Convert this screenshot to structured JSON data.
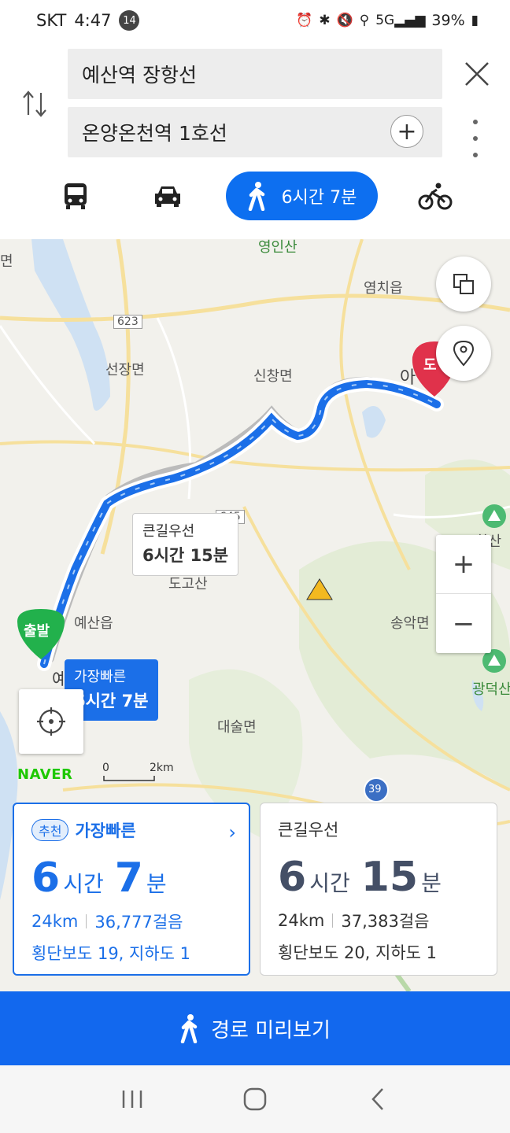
{
  "status": {
    "carrier": "SKT",
    "time": "4:47",
    "notif_count": "14",
    "battery": "39%"
  },
  "search": {
    "origin": "예산역 장항선",
    "destination": "온양온천역 1호선"
  },
  "tabs": {
    "walk_label": "6시간 7분"
  },
  "map": {
    "labels": [
      "영인산",
      "염치읍",
      "623",
      "선장면",
      "신창면",
      "큰길우선",
      "645",
      "도고산",
      "예산읍",
      "송악면",
      "대술면",
      "39",
      "광덕산",
      "면",
      "화산",
      "예산",
      "아",
      "도"
    ],
    "tip_alt": {
      "title": "큰길우선",
      "time": "6시간 15분"
    },
    "tip_fast": {
      "title": "가장빠른",
      "time": "6시간 7분"
    },
    "start_marker": "출발",
    "end_marker": "도",
    "scale_0": "0",
    "scale_2": "2km",
    "logo": "NAVER"
  },
  "routes": [
    {
      "badge": "추천",
      "title": "가장빠른",
      "hours": "6",
      "hours_unit": "시간",
      "minutes": "7",
      "minutes_unit": "분",
      "distance": "24km",
      "steps": "36,777걸음",
      "crossings": "횡단보도 19, 지하도 1"
    },
    {
      "title": "큰길우선",
      "hours": "6",
      "hours_unit": "시간",
      "minutes": "15",
      "minutes_unit": "분",
      "distance": "24km",
      "steps": "37,383걸음",
      "crossings": "횡단보도 20, 지하도 1"
    }
  ],
  "preview_button": "경로 미리보기",
  "colors": {
    "primary": "#1268ee",
    "route": "#1b6fe8",
    "start": "#22b14c",
    "end": "#e0324b"
  }
}
